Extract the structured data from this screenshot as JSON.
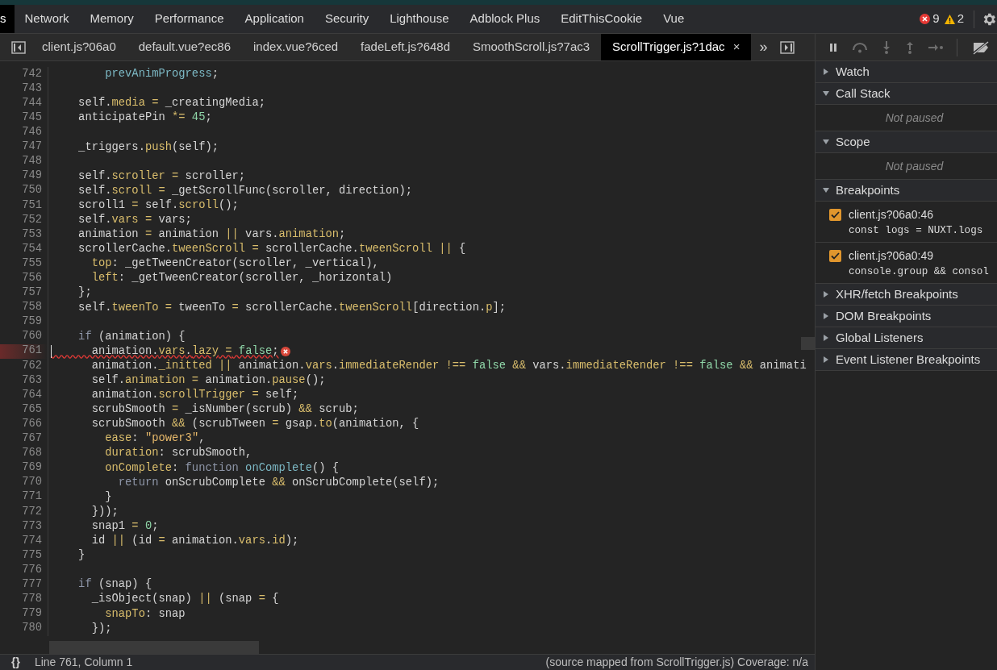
{
  "panel_tabs": [
    {
      "label": "s",
      "selected": true
    },
    {
      "label": "Network",
      "selected": false
    },
    {
      "label": "Memory",
      "selected": false
    },
    {
      "label": "Performance",
      "selected": false
    },
    {
      "label": "Application",
      "selected": false
    },
    {
      "label": "Security",
      "selected": false
    },
    {
      "label": "Lighthouse",
      "selected": false
    },
    {
      "label": "Adblock Plus",
      "selected": false
    },
    {
      "label": "EditThisCookie",
      "selected": false
    },
    {
      "label": "Vue",
      "selected": false
    }
  ],
  "issues": {
    "errors": "9",
    "warnings": "2"
  },
  "file_tabs": [
    {
      "label": "client.js?06a0",
      "selected": false
    },
    {
      "label": "default.vue?ec86",
      "selected": false
    },
    {
      "label": "index.vue?6ced",
      "selected": false
    },
    {
      "label": "fadeLeft.js?648d",
      "selected": false
    },
    {
      "label": "SmoothScroll.js?7ac3",
      "selected": false
    },
    {
      "label": "ScrollTrigger.js?1dac",
      "selected": true
    }
  ],
  "file_tabs_overflow": "»",
  "close_tab": "×",
  "code_lines": [
    {
      "number": "742",
      "tokens": [
        {
          "kind": "def",
          "text": "        prevAnimProgress"
        },
        {
          "kind": "plain",
          "text": ";"
        }
      ]
    },
    {
      "number": "743"
    },
    {
      "number": "744",
      "tokens": [
        {
          "kind": "plain",
          "text": "    self."
        },
        {
          "kind": "prop",
          "text": "media"
        },
        {
          "kind": "op",
          "text": " ="
        },
        {
          "kind": "plain",
          "text": " _creatingMedia;"
        }
      ]
    },
    {
      "number": "745",
      "tokens": [
        {
          "kind": "plain",
          "text": "    anticipatePin "
        },
        {
          "kind": "op",
          "text": "*="
        },
        {
          "kind": "num",
          "text": " 45"
        },
        {
          "kind": "plain",
          "text": ";"
        }
      ]
    },
    {
      "number": "746"
    },
    {
      "number": "747",
      "tokens": [
        {
          "kind": "plain",
          "text": "    _triggers."
        },
        {
          "kind": "prop",
          "text": "push"
        },
        {
          "kind": "plain",
          "text": "(self);"
        }
      ]
    },
    {
      "number": "748"
    },
    {
      "number": "749",
      "tokens": [
        {
          "kind": "plain",
          "text": "    self."
        },
        {
          "kind": "prop",
          "text": "scroller"
        },
        {
          "kind": "op",
          "text": " ="
        },
        {
          "kind": "plain",
          "text": " scroller;"
        }
      ]
    },
    {
      "number": "750",
      "tokens": [
        {
          "kind": "plain",
          "text": "    self."
        },
        {
          "kind": "prop",
          "text": "scroll"
        },
        {
          "kind": "op",
          "text": " ="
        },
        {
          "kind": "plain",
          "text": " _getScrollFunc(scroller, direction);"
        }
      ]
    },
    {
      "number": "751",
      "tokens": [
        {
          "kind": "plain",
          "text": "    scroll1 "
        },
        {
          "kind": "op",
          "text": "="
        },
        {
          "kind": "plain",
          "text": " self."
        },
        {
          "kind": "prop",
          "text": "scroll"
        },
        {
          "kind": "plain",
          "text": "();"
        }
      ]
    },
    {
      "number": "752",
      "tokens": [
        {
          "kind": "plain",
          "text": "    self."
        },
        {
          "kind": "prop",
          "text": "vars"
        },
        {
          "kind": "op",
          "text": " ="
        },
        {
          "kind": "plain",
          "text": " vars;"
        }
      ]
    },
    {
      "number": "753",
      "tokens": [
        {
          "kind": "plain",
          "text": "    animation "
        },
        {
          "kind": "op",
          "text": "="
        },
        {
          "kind": "plain",
          "text": " animation "
        },
        {
          "kind": "op",
          "text": "||"
        },
        {
          "kind": "plain",
          "text": " vars."
        },
        {
          "kind": "prop",
          "text": "animation"
        },
        {
          "kind": "plain",
          "text": ";"
        }
      ]
    },
    {
      "number": "754",
      "tokens": [
        {
          "kind": "plain",
          "text": "    scrollerCache."
        },
        {
          "kind": "prop",
          "text": "tweenScroll"
        },
        {
          "kind": "op",
          "text": " ="
        },
        {
          "kind": "plain",
          "text": " scrollerCache."
        },
        {
          "kind": "prop",
          "text": "tweenScroll"
        },
        {
          "kind": "op",
          "text": " ||"
        },
        {
          "kind": "plain",
          "text": " {"
        }
      ]
    },
    {
      "number": "755",
      "tokens": [
        {
          "kind": "prop",
          "text": "      top"
        },
        {
          "kind": "plain",
          "text": ": _getTweenCreator(scroller, _vertical),"
        }
      ]
    },
    {
      "number": "756",
      "tokens": [
        {
          "kind": "prop",
          "text": "      left"
        },
        {
          "kind": "plain",
          "text": ": _getTweenCreator(scroller, _horizontal)"
        }
      ]
    },
    {
      "number": "757",
      "tokens": [
        {
          "kind": "plain",
          "text": "    };"
        }
      ]
    },
    {
      "number": "758",
      "tokens": [
        {
          "kind": "plain",
          "text": "    self."
        },
        {
          "kind": "prop",
          "text": "tweenTo"
        },
        {
          "kind": "op",
          "text": " ="
        },
        {
          "kind": "plain",
          "text": " tweenTo "
        },
        {
          "kind": "op",
          "text": "="
        },
        {
          "kind": "plain",
          "text": " scrollerCache."
        },
        {
          "kind": "prop",
          "text": "tweenScroll"
        },
        {
          "kind": "plain",
          "text": "[direction."
        },
        {
          "kind": "prop",
          "text": "p"
        },
        {
          "kind": "plain",
          "text": "];"
        }
      ]
    },
    {
      "number": "759"
    },
    {
      "number": "760",
      "tokens": [
        {
          "kind": "kw",
          "text": "    if"
        },
        {
          "kind": "plain",
          "text": " (animation) {"
        }
      ]
    },
    {
      "number": "761",
      "error": true,
      "tokens": [
        {
          "kind": "plain",
          "text": "      animation."
        },
        {
          "kind": "prop",
          "text": "vars"
        },
        {
          "kind": "plain",
          "text": "."
        },
        {
          "kind": "prop",
          "text": "lazy"
        },
        {
          "kind": "op",
          "text": " ="
        },
        {
          "kind": "num",
          "text": " false"
        },
        {
          "kind": "plain",
          "text": ";"
        }
      ]
    },
    {
      "number": "762",
      "tokens": [
        {
          "kind": "plain",
          "text": "      animation."
        },
        {
          "kind": "prop",
          "text": "_initted"
        },
        {
          "kind": "op",
          "text": " ||"
        },
        {
          "kind": "plain",
          "text": " animation."
        },
        {
          "kind": "prop",
          "text": "vars"
        },
        {
          "kind": "plain",
          "text": "."
        },
        {
          "kind": "prop",
          "text": "immediateRender"
        },
        {
          "kind": "op",
          "text": " !=="
        },
        {
          "kind": "num",
          "text": " false"
        },
        {
          "kind": "op",
          "text": " &&"
        },
        {
          "kind": "plain",
          "text": " vars."
        },
        {
          "kind": "prop",
          "text": "immediateRender"
        },
        {
          "kind": "op",
          "text": " !=="
        },
        {
          "kind": "num",
          "text": " false"
        },
        {
          "kind": "op",
          "text": " &&"
        },
        {
          "kind": "plain",
          "text": " animati"
        }
      ]
    },
    {
      "number": "763",
      "tokens": [
        {
          "kind": "plain",
          "text": "      self."
        },
        {
          "kind": "prop",
          "text": "animation"
        },
        {
          "kind": "op",
          "text": " ="
        },
        {
          "kind": "plain",
          "text": " animation."
        },
        {
          "kind": "prop",
          "text": "pause"
        },
        {
          "kind": "plain",
          "text": "();"
        }
      ]
    },
    {
      "number": "764",
      "tokens": [
        {
          "kind": "plain",
          "text": "      animation."
        },
        {
          "kind": "prop",
          "text": "scrollTrigger"
        },
        {
          "kind": "op",
          "text": " ="
        },
        {
          "kind": "plain",
          "text": " self;"
        }
      ]
    },
    {
      "number": "765",
      "tokens": [
        {
          "kind": "plain",
          "text": "      scrubSmooth "
        },
        {
          "kind": "op",
          "text": "="
        },
        {
          "kind": "plain",
          "text": " _isNumber(scrub) "
        },
        {
          "kind": "op",
          "text": "&&"
        },
        {
          "kind": "plain",
          "text": " scrub;"
        }
      ]
    },
    {
      "number": "766",
      "tokens": [
        {
          "kind": "plain",
          "text": "      scrubSmooth "
        },
        {
          "kind": "op",
          "text": "&&"
        },
        {
          "kind": "plain",
          "text": " (scrubTween "
        },
        {
          "kind": "op",
          "text": "="
        },
        {
          "kind": "plain",
          "text": " gsap."
        },
        {
          "kind": "prop",
          "text": "to"
        },
        {
          "kind": "plain",
          "text": "(animation, {"
        }
      ]
    },
    {
      "number": "767",
      "tokens": [
        {
          "kind": "prop",
          "text": "        ease"
        },
        {
          "kind": "plain",
          "text": ": "
        },
        {
          "kind": "str",
          "text": "\"power3\""
        },
        {
          "kind": "plain",
          "text": ","
        }
      ]
    },
    {
      "number": "768",
      "tokens": [
        {
          "kind": "prop",
          "text": "        duration"
        },
        {
          "kind": "plain",
          "text": ": scrubSmooth,"
        }
      ]
    },
    {
      "number": "769",
      "tokens": [
        {
          "kind": "prop",
          "text": "        onComplete"
        },
        {
          "kind": "plain",
          "text": ": "
        },
        {
          "kind": "kw",
          "text": "function"
        },
        {
          "kind": "def",
          "text": " onComplete"
        },
        {
          "kind": "plain",
          "text": "() {"
        }
      ]
    },
    {
      "number": "770",
      "tokens": [
        {
          "kind": "kw",
          "text": "          return"
        },
        {
          "kind": "plain",
          "text": " onScrubComplete "
        },
        {
          "kind": "op",
          "text": "&&"
        },
        {
          "kind": "plain",
          "text": " onScrubComplete(self);"
        }
      ]
    },
    {
      "number": "771",
      "tokens": [
        {
          "kind": "plain",
          "text": "        }"
        }
      ]
    },
    {
      "number": "772",
      "tokens": [
        {
          "kind": "plain",
          "text": "      }));"
        }
      ]
    },
    {
      "number": "773",
      "tokens": [
        {
          "kind": "plain",
          "text": "      snap1 "
        },
        {
          "kind": "op",
          "text": "="
        },
        {
          "kind": "num",
          "text": " 0"
        },
        {
          "kind": "plain",
          "text": ";"
        }
      ]
    },
    {
      "number": "774",
      "tokens": [
        {
          "kind": "plain",
          "text": "      id "
        },
        {
          "kind": "op",
          "text": "||"
        },
        {
          "kind": "plain",
          "text": " (id "
        },
        {
          "kind": "op",
          "text": "="
        },
        {
          "kind": "plain",
          "text": " animation."
        },
        {
          "kind": "prop",
          "text": "vars"
        },
        {
          "kind": "plain",
          "text": "."
        },
        {
          "kind": "prop",
          "text": "id"
        },
        {
          "kind": "plain",
          "text": ");"
        }
      ]
    },
    {
      "number": "775",
      "tokens": [
        {
          "kind": "plain",
          "text": "    }"
        }
      ]
    },
    {
      "number": "776"
    },
    {
      "number": "777",
      "tokens": [
        {
          "kind": "kw",
          "text": "    if"
        },
        {
          "kind": "plain",
          "text": " (snap) {"
        }
      ]
    },
    {
      "number": "778",
      "tokens": [
        {
          "kind": "plain",
          "text": "      _isObject(snap) "
        },
        {
          "kind": "op",
          "text": "||"
        },
        {
          "kind": "plain",
          "text": " (snap "
        },
        {
          "kind": "op",
          "text": "="
        },
        {
          "kind": "plain",
          "text": " {"
        }
      ]
    },
    {
      "number": "779",
      "tokens": [
        {
          "kind": "prop",
          "text": "        snapTo"
        },
        {
          "kind": "plain",
          "text": ": snap"
        }
      ]
    },
    {
      "number": "780",
      "tokens": [
        {
          "kind": "plain",
          "text": "      });"
        }
      ]
    }
  ],
  "status_bar": {
    "format_button": "{}",
    "position": "Line 761, Column 1",
    "source": "(source mapped from ScrollTrigger.js) Coverage: n/a"
  },
  "sidebar_sections": [
    {
      "title": "Watch",
      "expanded": false
    },
    {
      "title": "Call Stack",
      "expanded": true,
      "message": "Not paused"
    },
    {
      "title": "Scope",
      "expanded": true,
      "message": "Not paused"
    },
    {
      "title": "Breakpoints",
      "expanded": true,
      "breakpoints": [
        {
          "location": "client.js?06a0:46",
          "code": "const logs = NUXT.logs",
          "checked": true
        },
        {
          "location": "client.js?06a0:49",
          "code": "console.group && consol",
          "checked": true
        }
      ]
    },
    {
      "title": "XHR/fetch Breakpoints",
      "expanded": false
    },
    {
      "title": "DOM Breakpoints",
      "expanded": false
    },
    {
      "title": "Global Listeners",
      "expanded": false
    },
    {
      "title": "Event Listener Breakpoints",
      "expanded": false
    }
  ]
}
